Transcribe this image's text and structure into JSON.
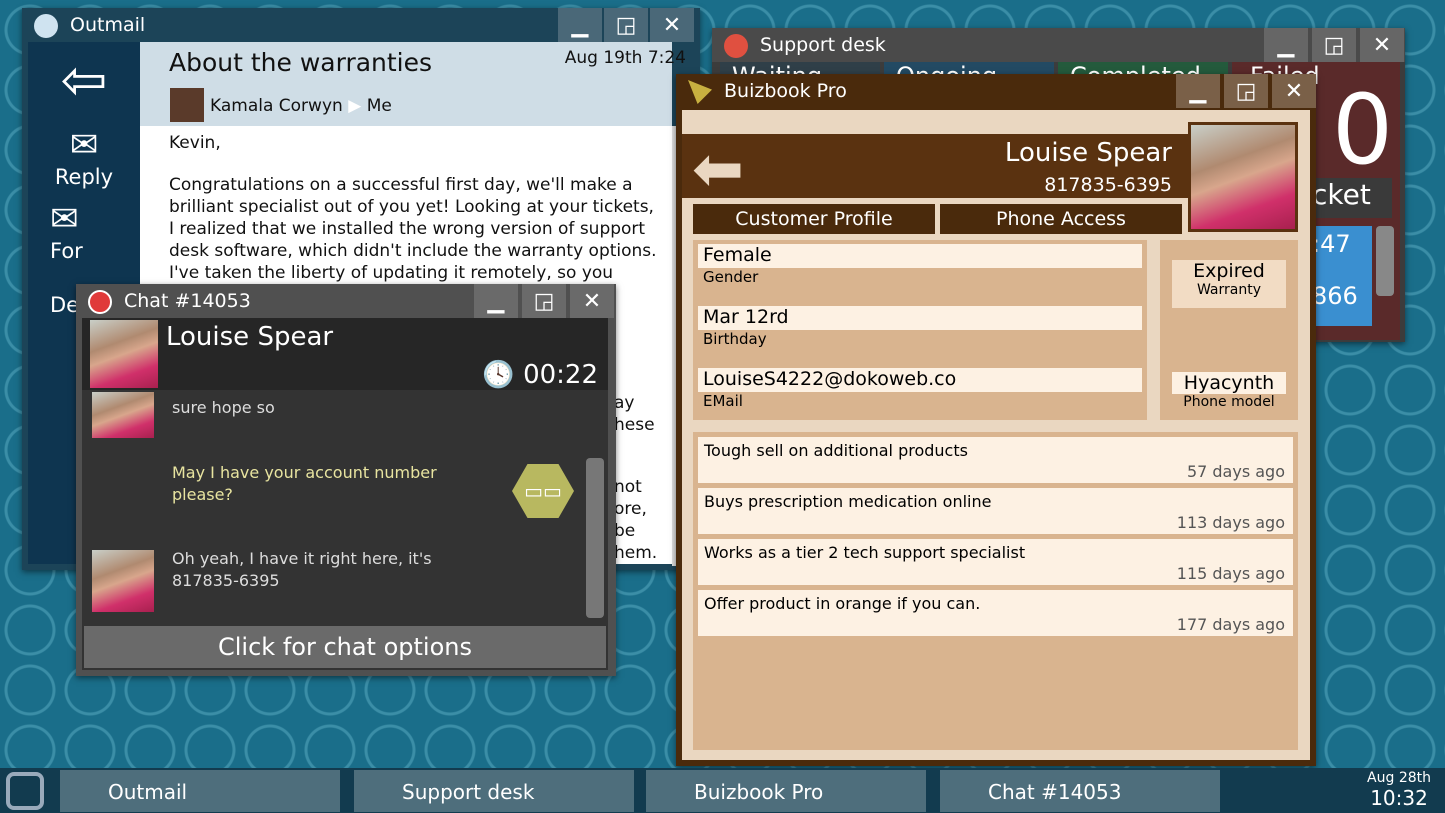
{
  "outmail": {
    "title": "Outmail",
    "subject": "About the warranties",
    "date": "Aug 19th 7:24",
    "from": "Kamala Corwyn",
    "to": "Me",
    "sidebar": [
      "Reply",
      "For",
      "De"
    ],
    "body": [
      "Kevin,",
      "Congratulations on a successful first day, we'll make a brilliant specialist out of you yet! Looking at your tickets, I realized that we installed the wrong version of support desk software, which didn't include the warranty options. I've taken the liberty of updating it remotely, so you should be"
    ],
    "peek": [
      "ay",
      "hese",
      "not",
      "ore,",
      "be",
      "hem."
    ]
  },
  "support": {
    "title": "Support desk",
    "tabs": [
      "Waiting",
      "Ongoing",
      "Completed",
      "Failed"
    ],
    "big": "0",
    "ticket": "cket",
    "time": ":47",
    "num": "866",
    "colors": {
      "waiting": "#2f3f48",
      "ongoing": "#234a63",
      "completed": "#245a3c",
      "failed": "#5a2a2a"
    }
  },
  "buiz": {
    "title": "Buizbook Pro",
    "name": "Louise Spear",
    "phone": "817835-6395",
    "tabs": [
      "Customer Profile",
      "Phone Access"
    ],
    "fields": [
      {
        "value": "Female",
        "label": "Gender"
      },
      {
        "value": "Mar 12rd",
        "label": "Birthday"
      },
      {
        "value": "LouiseS4222@dokoweb.co",
        "label": "EMail"
      }
    ],
    "side": [
      {
        "value": "Expired",
        "label": "Warranty"
      },
      {
        "value": "Hyacynth",
        "label": "Phone model"
      }
    ],
    "notes": [
      {
        "text": "Tough sell on additional products",
        "age": "57 days ago"
      },
      {
        "text": "Buys prescription medication online",
        "age": "113 days ago"
      },
      {
        "text": "Works as a tier 2 tech support specialist",
        "age": "115 days ago"
      },
      {
        "text": "Offer product in orange if you can.",
        "age": "177 days ago"
      }
    ]
  },
  "chat": {
    "title": "Chat #14053",
    "name": "Louise Spear",
    "timer": "00:22",
    "messages": [
      {
        "from": "customer",
        "text": "sure hope so"
      },
      {
        "from": "agent",
        "text": "May I have your account number please?"
      },
      {
        "from": "customer",
        "text": "Oh yeah, I have it right here, it's 817835-6395"
      }
    ],
    "options": "Click for chat options"
  },
  "taskbar": {
    "items": [
      "Outmail",
      "Support desk",
      "Buizbook Pro",
      "Chat #14053"
    ],
    "date": "Aug 28th",
    "time": "10:32"
  }
}
